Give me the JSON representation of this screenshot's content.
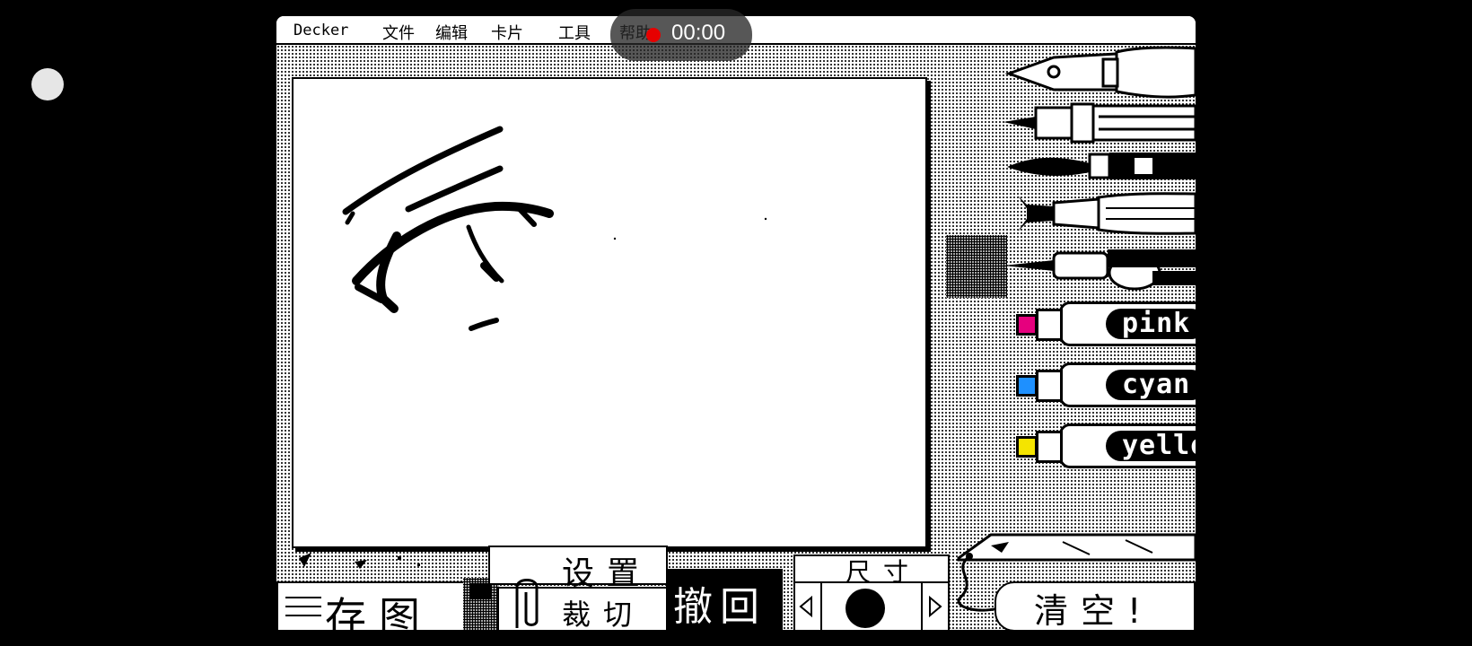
{
  "menubar": {
    "app_name": "Decker",
    "items": [
      "文件",
      "编辑",
      "卡片",
      "工具",
      "帮助"
    ]
  },
  "recording": {
    "time": "00:00"
  },
  "markers": [
    {
      "label": "pink",
      "color": "#e6007e"
    },
    {
      "label": "cyan",
      "color": "#1e90ff"
    },
    {
      "label": "yellow",
      "color": "#f4e400"
    }
  ],
  "toolbar": {
    "save_label": "存图",
    "settings_label": "设置",
    "crop_label": "裁切",
    "undo_label": "撤回",
    "size_label": "尺寸",
    "clear_label": "清空!"
  },
  "icons": {
    "prev": "left-arrow-icon",
    "next": "right-arrow-icon",
    "brush_size": "circle-icon"
  }
}
